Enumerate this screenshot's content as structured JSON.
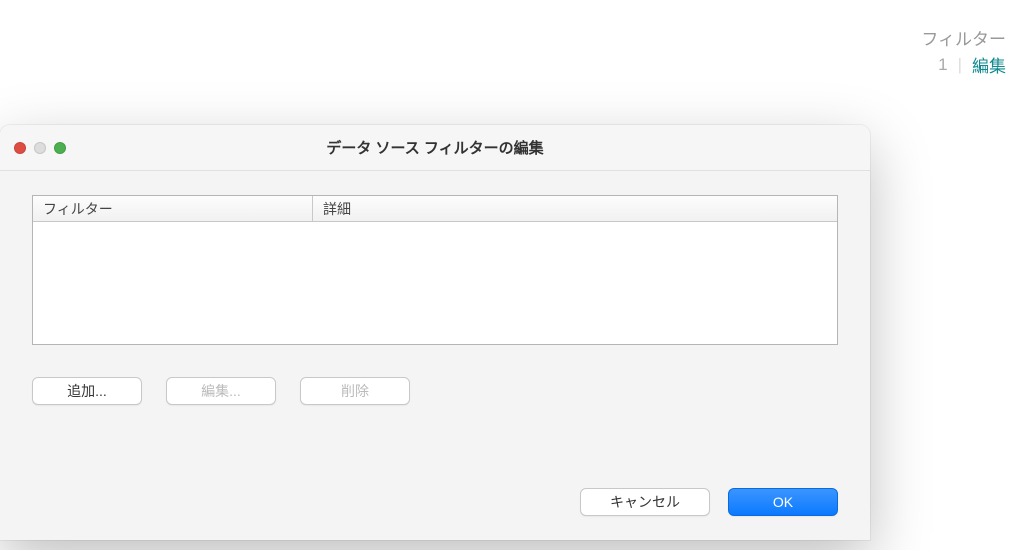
{
  "top_panel": {
    "filter_label": "フィルター",
    "filter_count": "1",
    "edit_link": "編集"
  },
  "dialog": {
    "title": "データ ソース フィルターの編集",
    "table": {
      "col_filter": "フィルター",
      "col_detail": "詳細"
    },
    "buttons": {
      "add": "追加...",
      "edit": "編集...",
      "delete": "削除"
    },
    "footer": {
      "cancel": "キャンセル",
      "ok": "OK"
    }
  }
}
